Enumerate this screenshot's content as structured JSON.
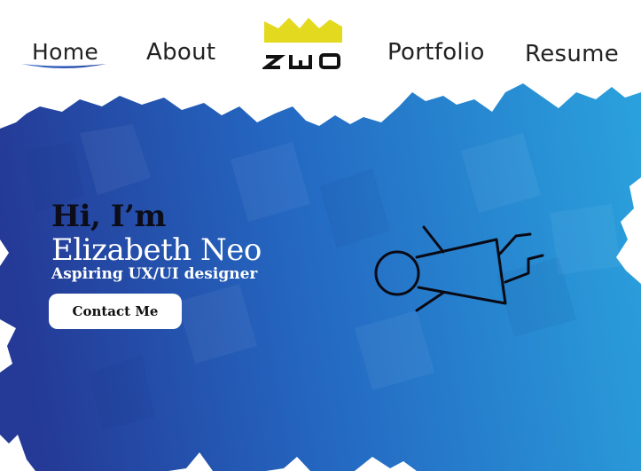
{
  "nav": {
    "items": [
      {
        "label": "Home",
        "active": true
      },
      {
        "label": "About",
        "active": false
      },
      {
        "label": "Portfolio",
        "active": false
      },
      {
        "label": "Resume",
        "active": false
      }
    ]
  },
  "logo": {
    "letters": [
      "N",
      "E",
      "O"
    ],
    "icon": "crown-icon"
  },
  "hero": {
    "greeting": "Hi, I’m",
    "name": "Elizabeth Neo",
    "role": "Aspiring UX/UI designer",
    "cta_label": "Contact Me",
    "illustration": "flying-figure-icon"
  },
  "colors": {
    "hero_start": "#243a96",
    "hero_end": "#2aa0dc",
    "crown": "#e3da1f",
    "underline": "#2b55b8"
  }
}
